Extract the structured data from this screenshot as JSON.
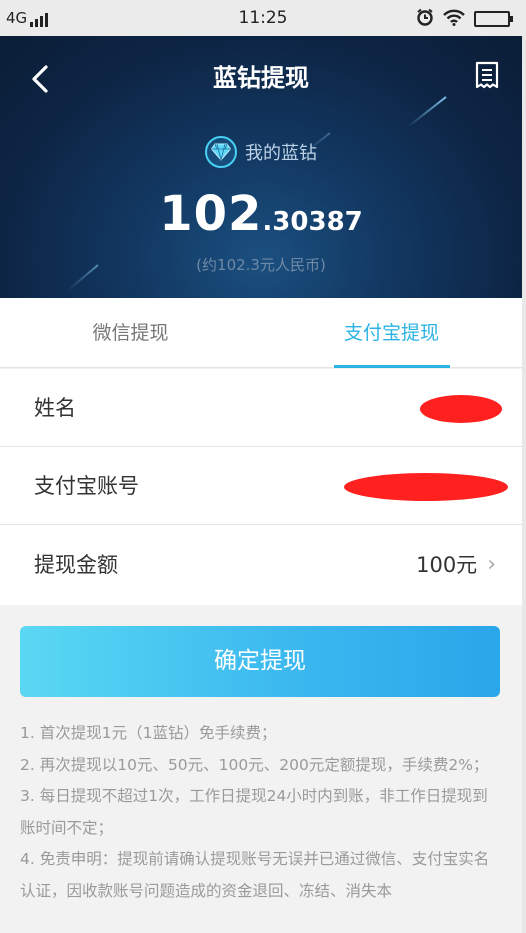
{
  "status_bar": {
    "network": "4G",
    "time": "11:25"
  },
  "header": {
    "title": "蓝钻提现",
    "wallet_label": "我的蓝钻",
    "balance_int": "102",
    "balance_dec": ".30387",
    "rmb_note": "(约102.3元人民币)"
  },
  "tabs": [
    {
      "label": "微信提现",
      "active": false
    },
    {
      "label": "支付宝提现",
      "active": true
    }
  ],
  "form": {
    "name_label": "姓名",
    "account_label": "支付宝账号",
    "amount_label": "提现金额",
    "amount_value": "100元"
  },
  "confirm_label": "确定提现",
  "notes": [
    "1. 首次提现1元（1蓝钻）免手续费；",
    "2. 再次提现以10元、50元、100元、200元定额提现，手续费2%；",
    "3. 每日提现不超过1次，工作日提现24小时内到账，非工作日提现到账时间不定；",
    "4. 免责申明：提现前请确认提现账号无误并已通过微信、支付宝实名认证，因收款账号问题造成的资金退回、冻结、消失本"
  ],
  "icons": {
    "back": "chevron-left-icon",
    "bill": "bill-list-icon",
    "diamond": "diamond-icon",
    "amount_arrow": "chevron-right-icon"
  },
  "colors": {
    "accent": "#2bb3e3",
    "hero_dark": "#0d2545",
    "redaction": "#ff2020"
  }
}
